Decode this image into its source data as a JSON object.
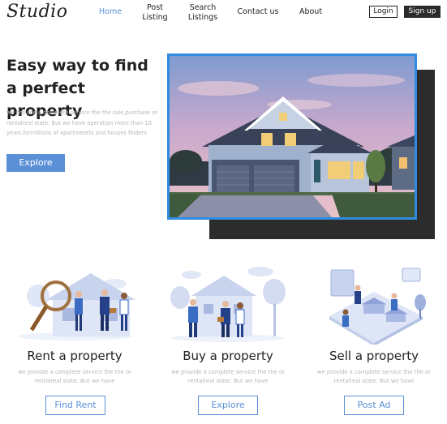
{
  "nav": {
    "logo": "Studio",
    "links": [
      {
        "line1": "Home",
        "line2": ""
      },
      {
        "line1": "Post",
        "line2": "Listing"
      },
      {
        "line1": "Search",
        "line2": "Listings"
      },
      {
        "line1": "Contact us",
        "line2": ""
      },
      {
        "line1": "About",
        "line2": ""
      }
    ],
    "login_label": "Login",
    "signup_label": "Sign up"
  },
  "hero": {
    "title": "Easy way to find a perfect property",
    "text": "we provide a complete service the the sale,purchase or rentalreal state. But we have operation more than 10 years.formillions of apartmentts and houses finders",
    "button_label": "Explore"
  },
  "cards": [
    {
      "title": "Rent a property",
      "text": "we provide a complete service the the or rentalreal state. But we have",
      "button_label": "Find Rent"
    },
    {
      "title": "Buy a property",
      "text": "we provide a complete service the the or rentalreal state. But we have",
      "button_label": "Explore"
    },
    {
      "title": "Sell a property",
      "text": "we provide a complete service the the or rentalreal state. But we have",
      "button_label": "Post Ad"
    }
  ],
  "colors": {
    "accent": "#5b8fd6",
    "image_border": "#2f8de0",
    "dark": "#2b2b2b"
  }
}
